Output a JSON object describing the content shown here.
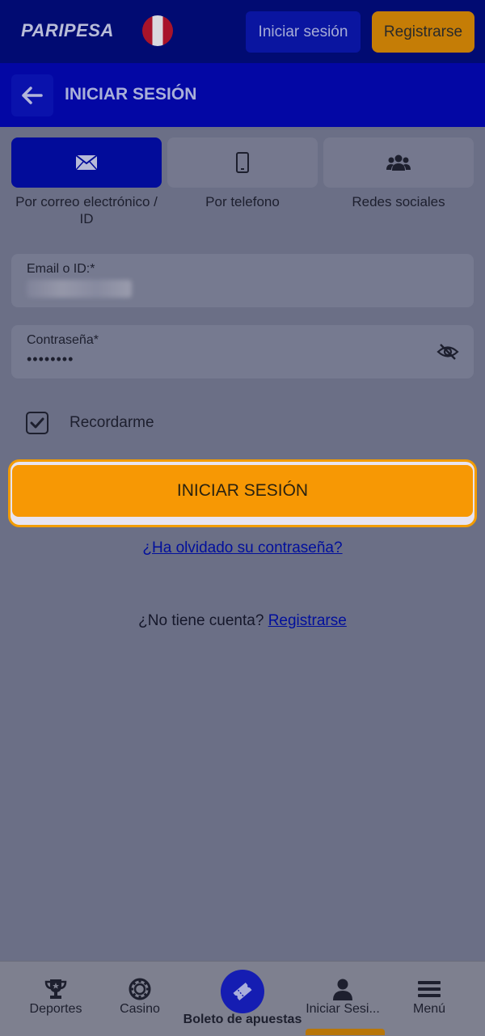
{
  "topbar": {
    "logo": "PARIPESA",
    "login_button": "Iniciar sesión",
    "register_button": "Registrarse"
  },
  "header": {
    "title": "INICIAR SESIÓN"
  },
  "tabs": [
    {
      "label": "Por correo electrónico / ID",
      "icon": "envelope-icon",
      "active": true
    },
    {
      "label": "Por telefono",
      "icon": "phone-icon",
      "active": false
    },
    {
      "label": "Redes sociales",
      "icon": "users-icon",
      "active": false
    }
  ],
  "form": {
    "email_label": "Email o ID:*",
    "password_label": "Contraseña*",
    "password_value": "••••••••",
    "remember_label": "Recordarme",
    "remember_checked": true,
    "submit_label": "INICIAR SESIÓN",
    "forgot_link": "¿Ha olvidado su contraseña?",
    "no_account_text": "¿No tiene cuenta?",
    "register_link": "Registrarse"
  },
  "bottom_nav": [
    {
      "label": "Deportes",
      "icon": "trophy-icon"
    },
    {
      "label": "Casino",
      "icon": "chip-icon"
    },
    {
      "label": "Boleto de apuestas",
      "icon": "ticket-icon"
    },
    {
      "label": "Iniciar Sesi...",
      "icon": "user-icon"
    },
    {
      "label": "Menú",
      "icon": "menu-icon"
    }
  ],
  "colors": {
    "primary_blue": "#0307a4",
    "accent_orange": "#f79804",
    "link_blue": "#010f9c"
  }
}
